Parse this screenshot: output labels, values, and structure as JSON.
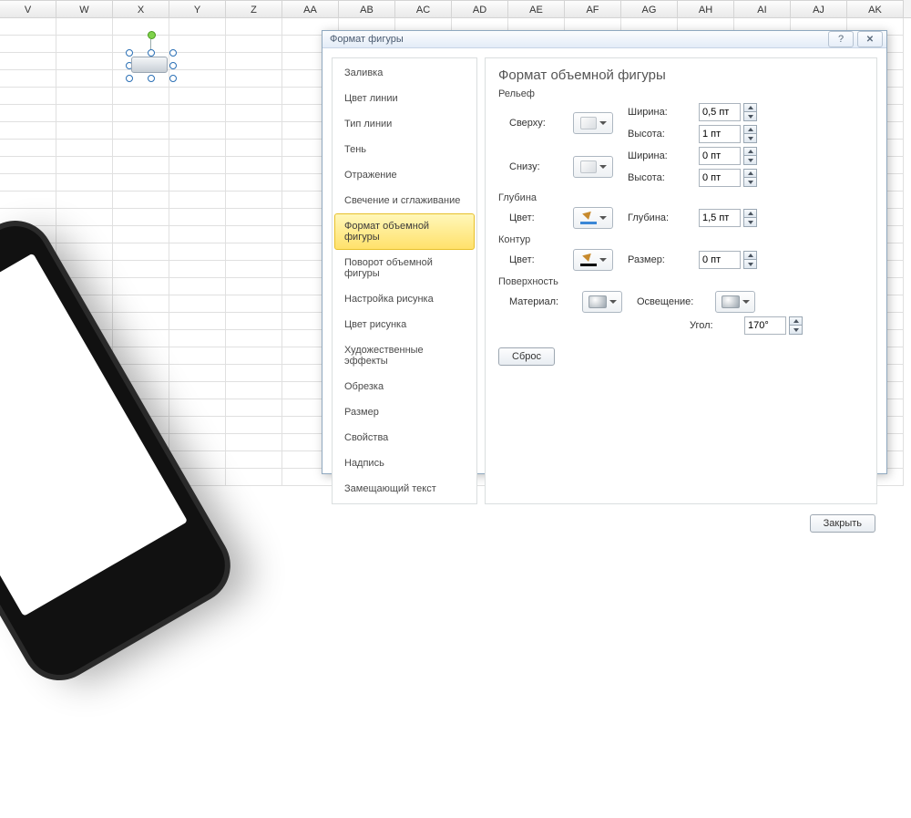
{
  "columns": [
    "V",
    "W",
    "X",
    "Y",
    "Z",
    "AA",
    "AB",
    "AC",
    "AD",
    "AE",
    "AF",
    "AG",
    "AH",
    "AI",
    "AJ",
    "AK"
  ],
  "dialog": {
    "title": "Формат фигуры",
    "nav": [
      "Заливка",
      "Цвет линии",
      "Тип линии",
      "Тень",
      "Отражение",
      "Свечение и сглаживание",
      "Формат объемной фигуры",
      "Поворот объемной фигуры",
      "Настройка рисунка",
      "Цвет рисунка",
      "Художественные эффекты",
      "Обрезка",
      "Размер",
      "Свойства",
      "Надпись",
      "Замещающий текст"
    ],
    "active_index": 6,
    "content": {
      "title": "Формат объемной фигуры",
      "sections": {
        "relief": "Рельеф",
        "depth": "Глубина",
        "contour": "Контур",
        "surface": "Поверхность"
      },
      "labels": {
        "top": "Сверху:",
        "bottom": "Снизу:",
        "width": "Ширина:",
        "height": "Высота:",
        "color": "Цвет:",
        "depth_val": "Глубина:",
        "size": "Размер:",
        "material": "Материал:",
        "lighting": "Освещение:",
        "angle": "Угол:"
      },
      "values": {
        "top_width": "0,5 пт",
        "top_height": "1 пт",
        "bottom_width": "0 пт",
        "bottom_height": "0 пт",
        "depth_color": "#3b87d6",
        "depth_value": "1,5 пт",
        "contour_color": "#000000",
        "contour_size": "0 пт",
        "angle": "170°"
      },
      "buttons": {
        "reset": "Сброс",
        "close": "Закрыть"
      }
    }
  }
}
